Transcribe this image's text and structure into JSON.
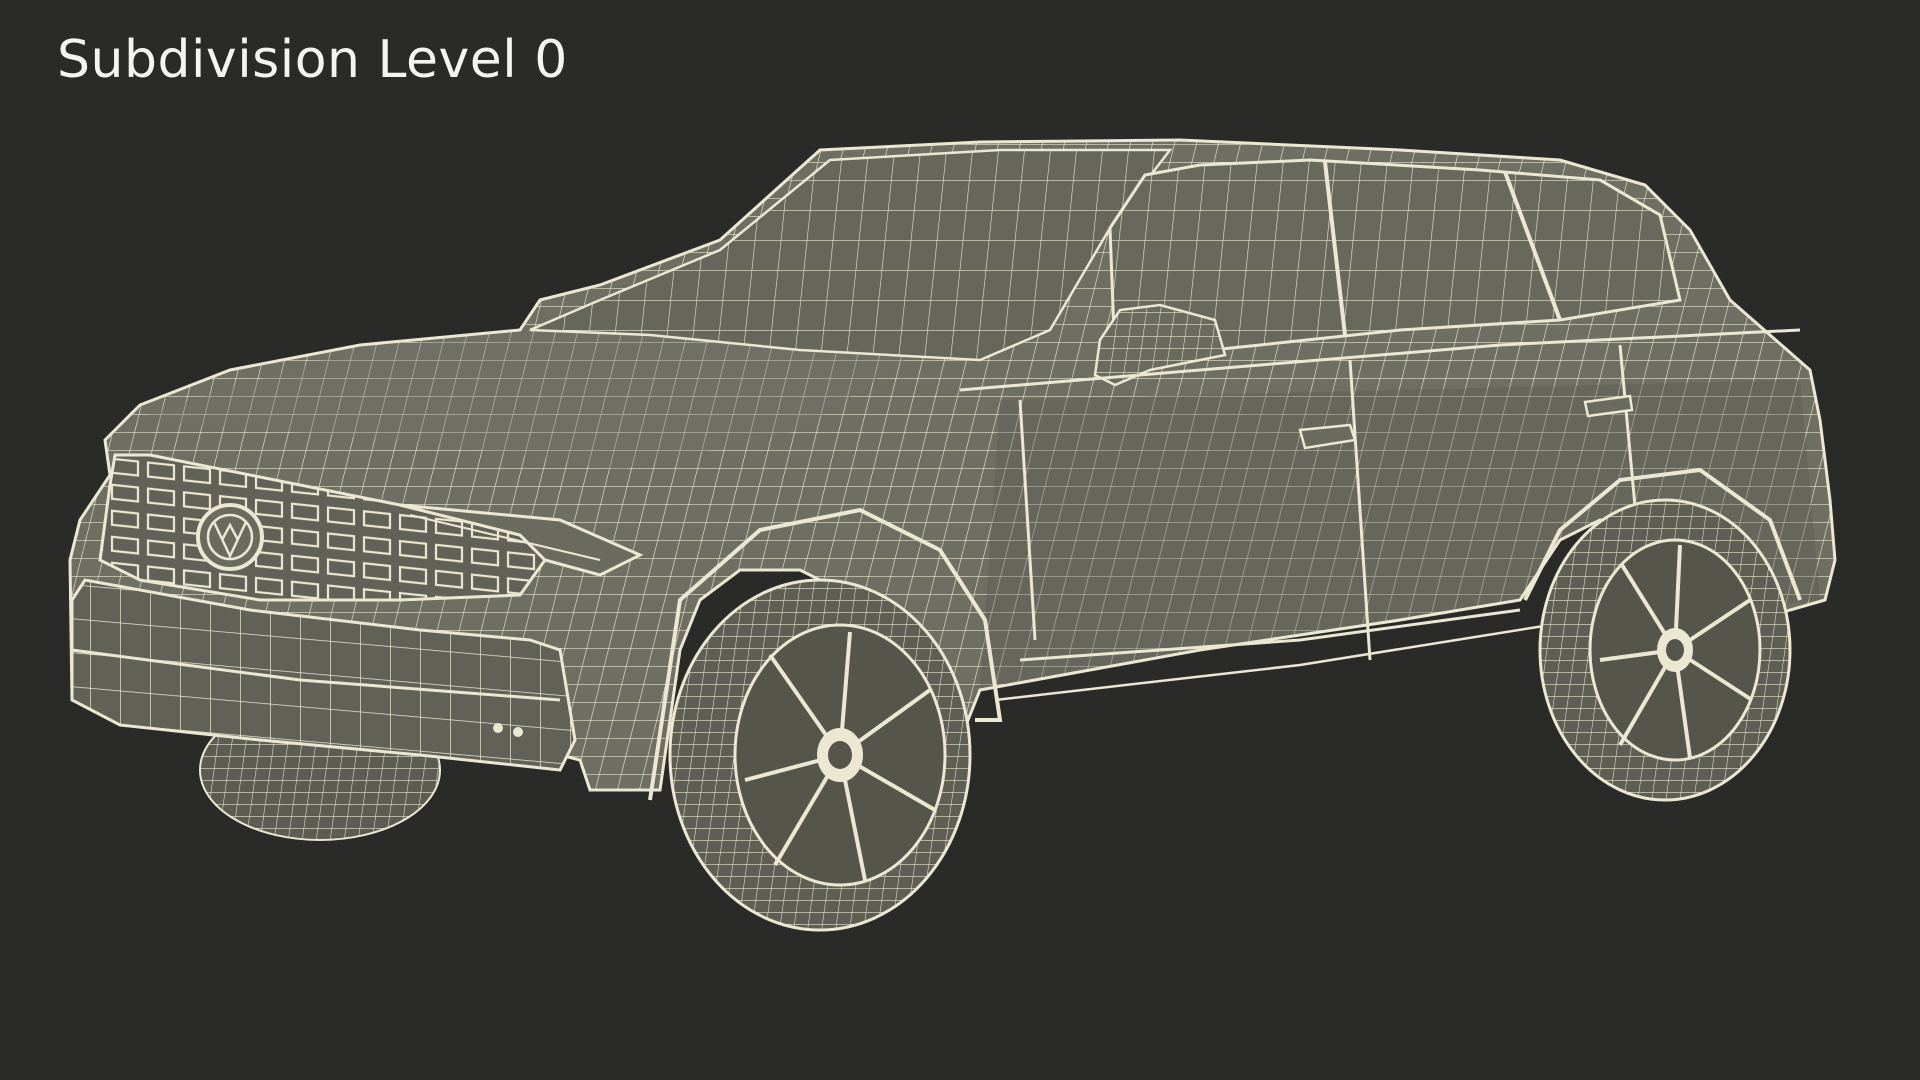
{
  "caption": "Subdivision Level 0",
  "colors": {
    "background": "#2a2a28",
    "body_fill": "#6e6e63",
    "body_shade": "#5a5a50",
    "wire": "#ebe7d2",
    "caption": "#f4f4f0"
  }
}
